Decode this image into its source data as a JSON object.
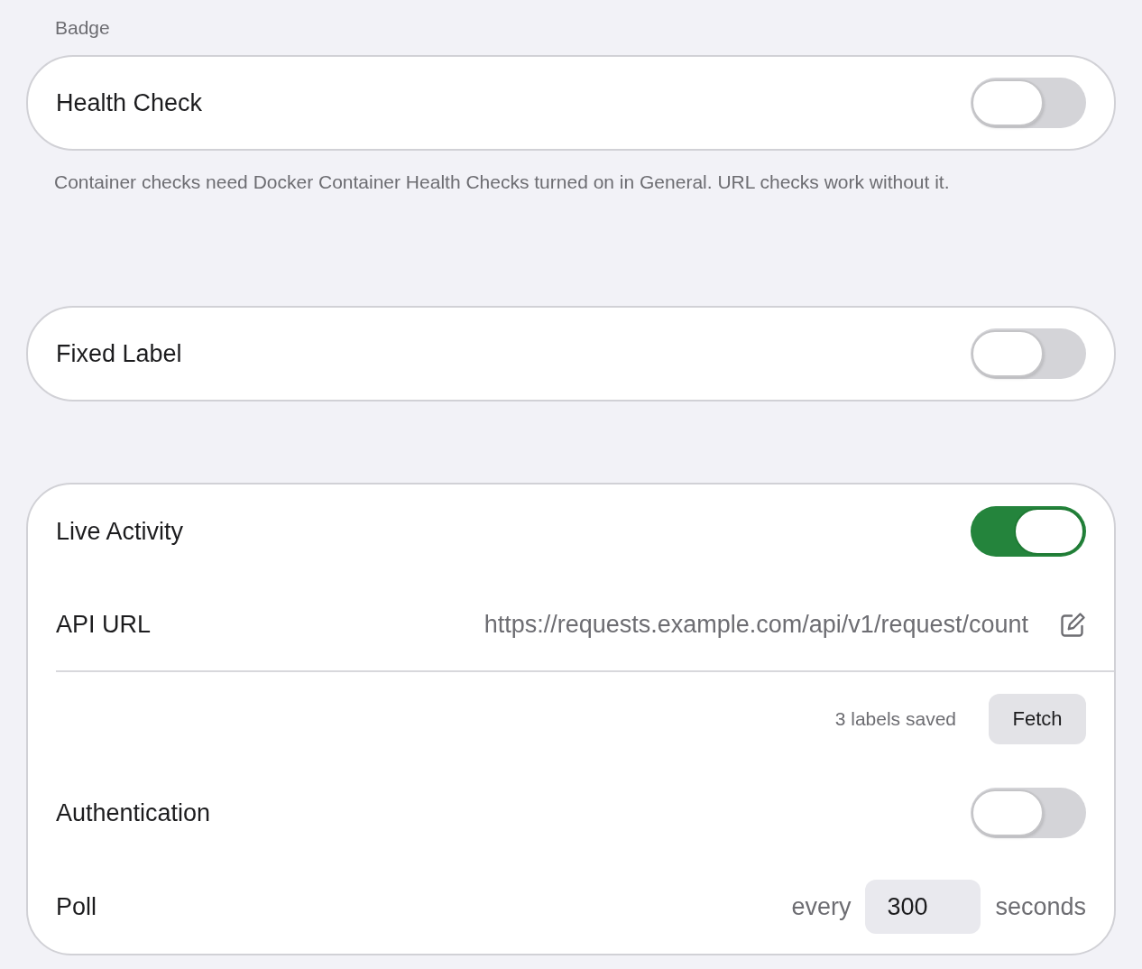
{
  "sections": [
    {
      "header": "Badge",
      "rows": [
        {
          "kind": "toggle",
          "label": "Health Check",
          "on": false
        }
      ],
      "footer": "Container checks need Docker Container Health Checks turned on in General. URL checks work without it."
    },
    {
      "rows": [
        {
          "kind": "toggle",
          "label": "Fixed Label",
          "on": false
        }
      ]
    },
    {
      "rows": [
        {
          "kind": "toggle",
          "label": "Live Activity",
          "on": true
        },
        {
          "kind": "url",
          "label": "API URL",
          "value": "https://requests.example.com/api/v1/request/count"
        },
        {
          "kind": "action",
          "status": "3 labels saved",
          "button": "Fetch"
        },
        {
          "kind": "toggle",
          "label": "Authentication",
          "on": false
        },
        {
          "kind": "number",
          "label": "Poll",
          "prefix": "every",
          "value": "300",
          "suffix": "seconds"
        }
      ]
    }
  ]
}
